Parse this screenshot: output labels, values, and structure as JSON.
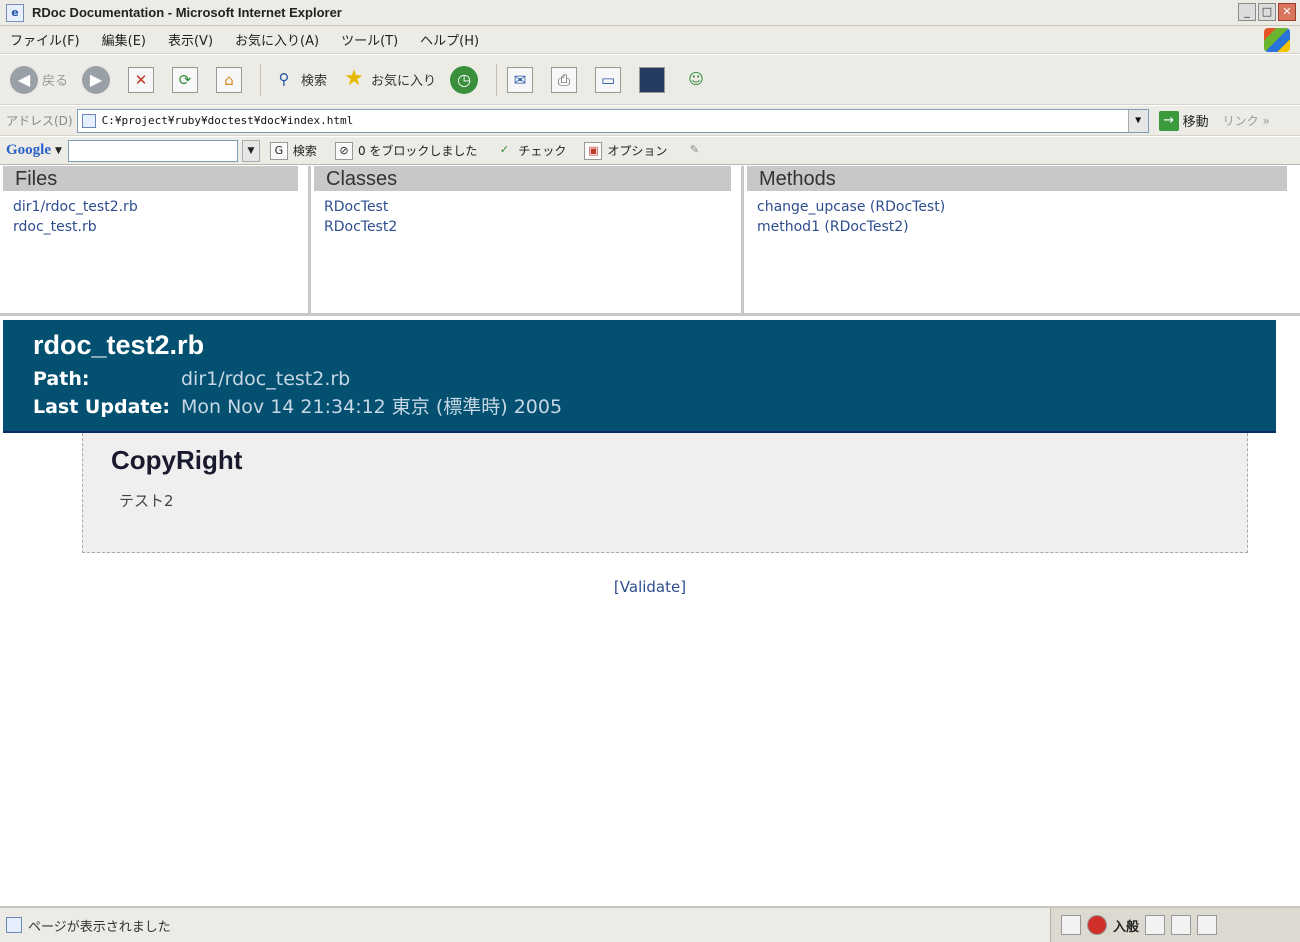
{
  "window": {
    "title": "RDoc Documentation - Microsoft Internet Explorer",
    "controls": {
      "minimize": "_",
      "maximize": "□",
      "close": "✕"
    }
  },
  "menubar": {
    "items": [
      "ファイル(F)",
      "編集(E)",
      "表示(V)",
      "お気に入り(A)",
      "ツール(T)",
      "ヘルプ(H)"
    ]
  },
  "toolbar": {
    "back_label": "戻る",
    "search_label": "検索",
    "favorites_label": "お気に入り"
  },
  "addressbar": {
    "label": "アドレス(D)",
    "url": "C:¥project¥ruby¥doctest¥doc¥index.html",
    "go_label": "移動",
    "links_label": "リンク »"
  },
  "googlebar": {
    "logo": "Google",
    "search_value": "",
    "search_label": "検索",
    "blocked_label": "0 をブロックしました",
    "check_label": "チェック",
    "options_label": "オプション"
  },
  "frames": {
    "files": {
      "heading": "Files",
      "items": [
        "dir1/rdoc_test2.rb",
        "rdoc_test.rb"
      ]
    },
    "classes": {
      "heading": "Classes",
      "items": [
        "RDocTest",
        "RDocTest2"
      ]
    },
    "methods": {
      "heading": "Methods",
      "items": [
        "change_upcase (RDocTest)",
        "method1 (RDocTest2)"
      ]
    }
  },
  "content": {
    "file_title": "rdoc_test2.rb",
    "path_label": "Path:",
    "path_value": "dir1/rdoc_test2.rb",
    "update_label": "Last Update:",
    "update_value": "Mon Nov 14 21:34:12 東京 (標準時) 2005",
    "section_title": "CopyRight",
    "section_text": "テスト2",
    "validate_link": "[Validate]"
  },
  "statusbar": {
    "text": "ページが表示されました",
    "ime_label": "入般"
  },
  "colors": {
    "banner_bg": "#045070",
    "link": "#2e4d8f",
    "frame_heading_bg": "#c8c8c8"
  }
}
